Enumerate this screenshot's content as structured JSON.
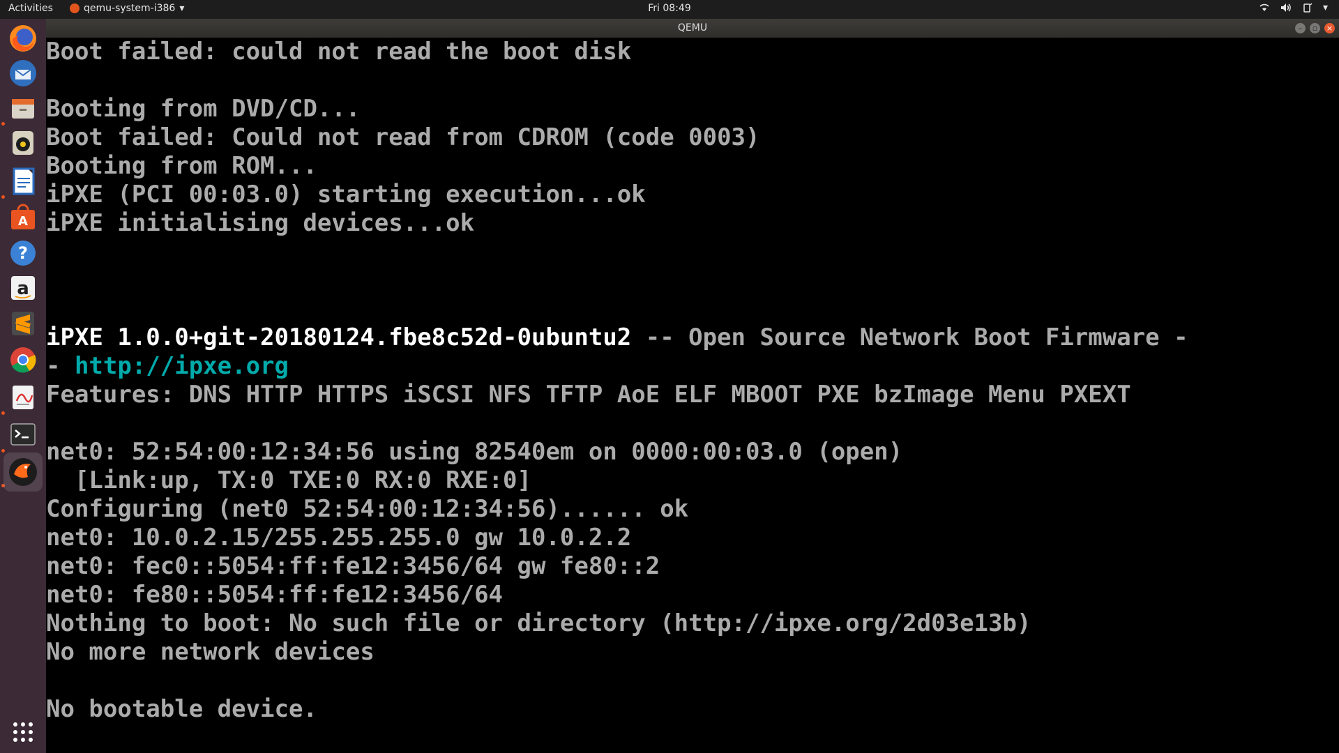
{
  "topbar": {
    "activities": "Activities",
    "app_menu": "qemu-system-i386",
    "clock": "Fri 08:49"
  },
  "window": {
    "title": "QEMU"
  },
  "launcher": {
    "apps": [
      "firefox-icon",
      "thunderbird-icon",
      "files-icon",
      "rhythmbox-icon",
      "writer-icon",
      "software-center-icon",
      "help-icon",
      "amazon-icon",
      "sublime-text-icon",
      "chrome-icon",
      "document-viewer-icon",
      "terminal-icon",
      "qemu-icon",
      "show-apps-icon"
    ]
  },
  "console": {
    "lines": [
      "Boot failed: could not read the boot disk",
      "",
      "Booting from DVD/CD...",
      "Boot failed: Could not read from CDROM (code 0003)",
      "Booting from ROM...",
      "iPXE (PCI 00:03.0) starting execution...ok",
      "iPXE initialising devices...ok",
      "",
      "",
      "",
      "iPXE 1.0.0+git-20180124.fbe8c52d-0ubuntu2",
      " -- Open Source Network Boot Firmware -",
      "- ",
      "http://ipxe.org",
      "Features: DNS HTTP HTTPS iSCSI NFS TFTP AoE ELF MBOOT PXE bzImage Menu PXEXT",
      "",
      "net0: 52:54:00:12:34:56 using 82540em on 0000:00:03.0 (open)",
      "  [Link:up, TX:0 TXE:0 RX:0 RXE:0]",
      "Configuring (net0 52:54:00:12:34:56)...... ok",
      "net0: 10.0.2.15/255.255.255.0 gw 10.0.2.2",
      "net0: fec0::5054:ff:fe12:3456/64 gw fe80::2",
      "net0: fe80::5054:ff:fe12:3456/64",
      "Nothing to boot: No such file or directory (http://ipxe.org/2d03e13b)",
      "No more network devices",
      "",
      "No bootable device."
    ]
  }
}
